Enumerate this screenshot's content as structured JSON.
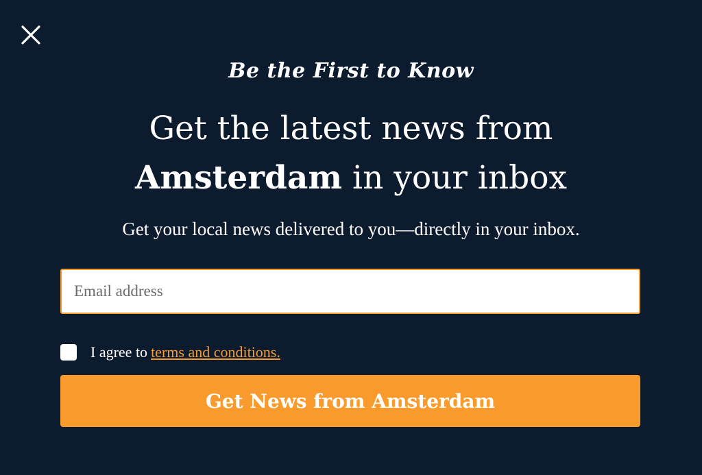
{
  "close": {
    "icon": "close-icon"
  },
  "kicker": "Be the First to Know",
  "headline": {
    "line1": "Get the latest news from",
    "strong": "Amsterdam",
    "line2_rest": " in your inbox"
  },
  "subhead": "Get your local news delivered to you—directly in your inbox.",
  "email": {
    "placeholder": "Email address",
    "value": ""
  },
  "agree": {
    "checked": false,
    "text": "I agree to",
    "link_text": "terms and conditions."
  },
  "submit": {
    "label": "Get News from Amsterdam"
  },
  "colors": {
    "background": "#0c1b2e",
    "accent": "#f99b2c",
    "text": "#ffffff"
  }
}
